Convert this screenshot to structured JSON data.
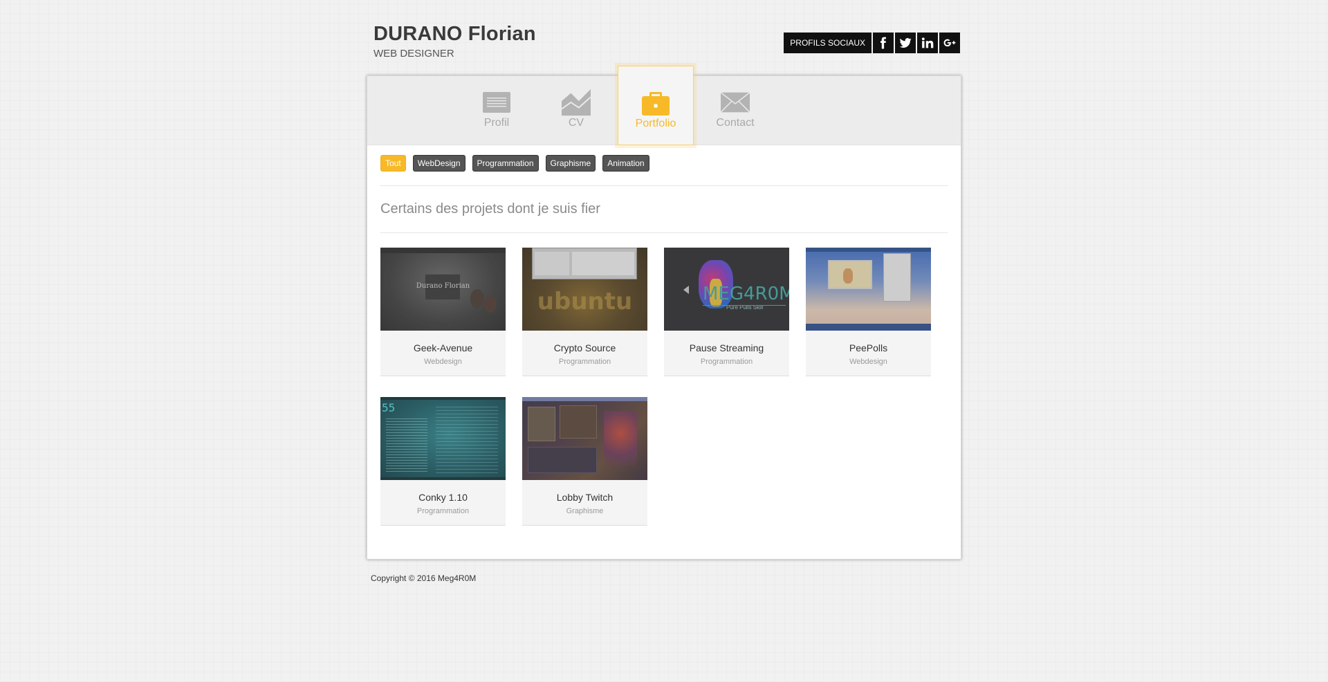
{
  "header": {
    "name": "DURANO Florian",
    "role": "WEB DESIGNER",
    "social_label": "PROFILS SOCIAUX",
    "social_icons": [
      "facebook-icon",
      "twitter-icon",
      "linkedin-icon",
      "google-plus-icon"
    ]
  },
  "nav": {
    "items": [
      {
        "label": "Profil",
        "icon": "profile-icon"
      },
      {
        "label": "CV",
        "icon": "chart-icon"
      },
      {
        "label": "Portfolio",
        "icon": "briefcase-icon",
        "active": true
      },
      {
        "label": "Contact",
        "icon": "envelope-icon"
      }
    ]
  },
  "filters": [
    "Tout",
    "WebDesign",
    "Programmation",
    "Graphisme",
    "Animation"
  ],
  "active_filter": "Tout",
  "section_title": "Certains des projets dont je suis fier",
  "projects": [
    {
      "title": "Geek-Avenue",
      "category": "Webdesign"
    },
    {
      "title": "Crypto Source",
      "category": "Programmation"
    },
    {
      "title": "Pause Streaming",
      "category": "Programmation"
    },
    {
      "title": "PeePolls",
      "category": "Webdesign"
    },
    {
      "title": "Conky 1.10",
      "category": "Programmation"
    },
    {
      "title": "Lobby Twitch",
      "category": "Graphisme"
    }
  ],
  "thumb_text": {
    "geek_avenue": "Durano Florian",
    "crypto_source": "ubuntu",
    "pause_streaming": "MEG4R0M",
    "pause_streaming_sub": "Pure Pulls Skill",
    "conky": "55"
  },
  "colors": {
    "accent": "#f7b928",
    "filter_bg": "#555555",
    "nav_bg": "#ececec"
  },
  "footer": "Copyright © 2016 Meg4R0M"
}
